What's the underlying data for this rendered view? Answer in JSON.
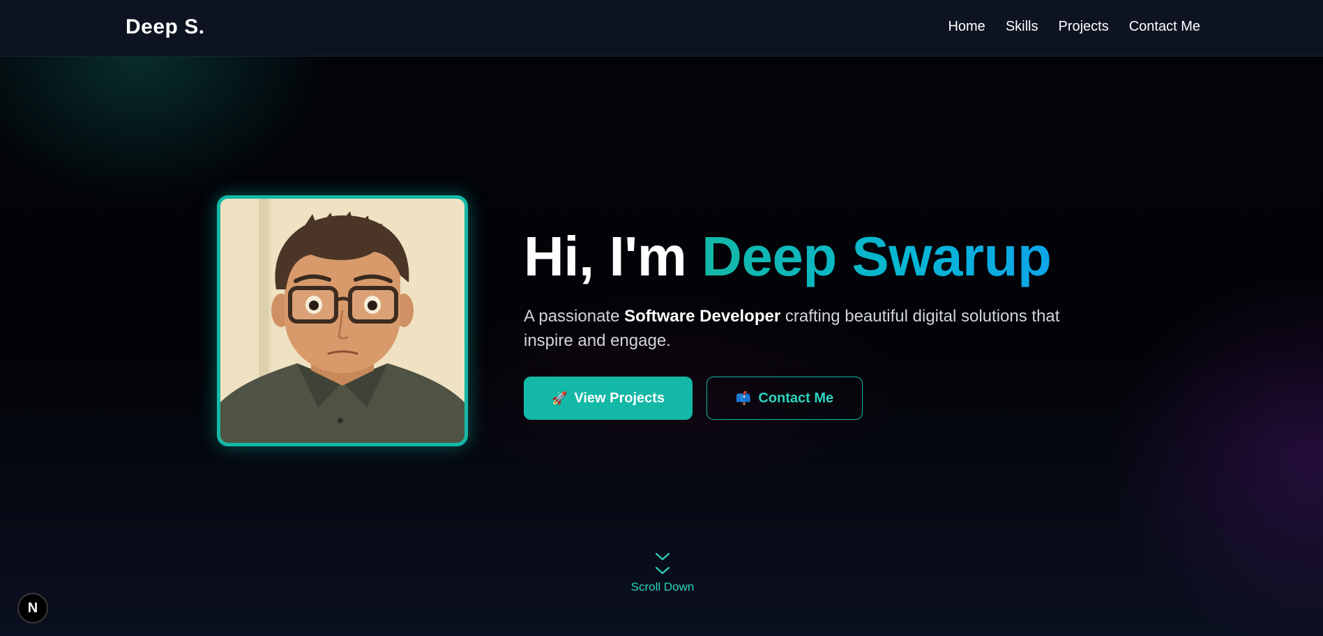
{
  "header": {
    "brand": "Deep S.",
    "nav": [
      "Home",
      "Skills",
      "Projects",
      "Contact Me"
    ]
  },
  "hero": {
    "greeting": "Hi, I'm ",
    "name": "Deep Swarup",
    "tagline_prefix": "A passionate ",
    "tagline_bold": "Software Developer",
    "tagline_suffix": " crafting beautiful digital solutions that inspire and engage.",
    "primary_button": {
      "icon": "rocket-icon",
      "emoji": "🚀",
      "label": "View Projects"
    },
    "secondary_button": {
      "icon": "mailbox-icon",
      "emoji": "📫",
      "label": "Contact Me"
    }
  },
  "scroll": {
    "label": "Scroll Down",
    "icon": "double-chevron-down-icon"
  },
  "badge": {
    "letter": "N",
    "icon": "nextjs-icon"
  },
  "colors": {
    "accent": "#14b8a6",
    "accent_light": "#2dd4bf",
    "gradient_end": "#0ea5e9",
    "header_bg": "#0d1321",
    "page_bg": "#020307"
  }
}
